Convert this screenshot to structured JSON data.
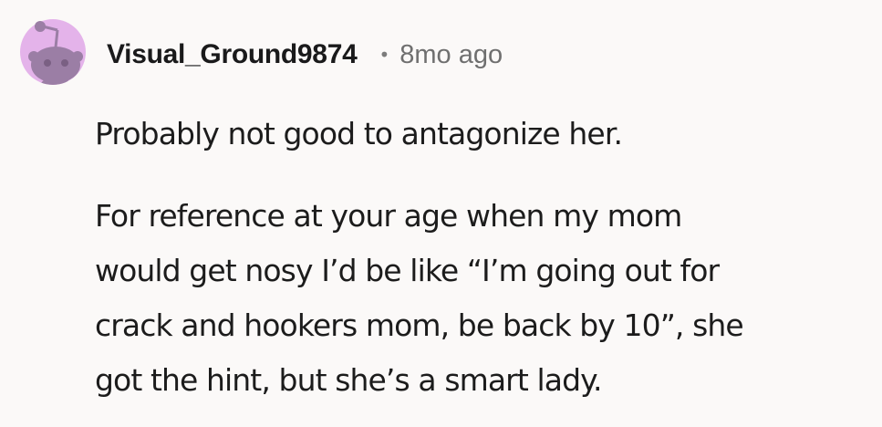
{
  "comment": {
    "username": "Visual_Ground9874",
    "separator": "•",
    "timestamp": "8mo ago",
    "avatar_icon": "reddit-snoo-avatar-icon",
    "paragraphs": [
      [
        "Probably not good to antagonize her."
      ],
      [
        "For reference at your age when my mom",
        "would get nosy I’d be like “I’m going out for",
        "crack and hookers mom, be back by 10”, she",
        "got the hint, but she’s a smart lady."
      ]
    ]
  },
  "colors": {
    "background": "#fbf9f8",
    "avatar_bg": "#e4b3ea",
    "avatar_figure": "#9b7ea5",
    "text": "#1c1c1c",
    "meta": "#6f6f6f"
  }
}
